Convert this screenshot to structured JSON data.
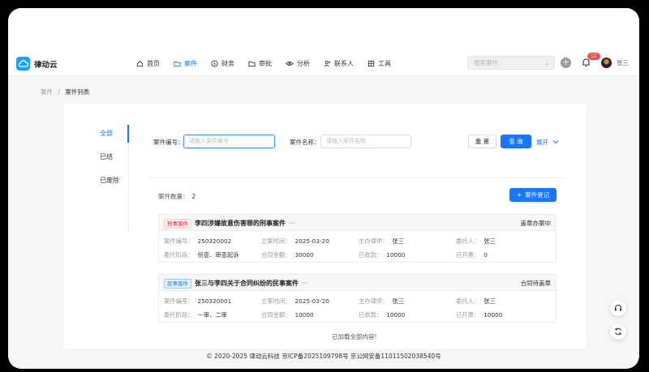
{
  "brand": {
    "name": "律动云"
  },
  "nav": {
    "items": [
      {
        "label": "首页",
        "icon": "home-icon"
      },
      {
        "label": "案件",
        "icon": "folder-icon",
        "active": true
      },
      {
        "label": "财务",
        "icon": "dollar-icon"
      },
      {
        "label": "审批",
        "icon": "folder-check-icon"
      },
      {
        "label": "分析",
        "icon": "eye-icon"
      },
      {
        "label": "联系人",
        "icon": "contacts-icon"
      },
      {
        "label": "工具",
        "icon": "tools-icon"
      }
    ]
  },
  "header": {
    "search_placeholder": "搜索案件",
    "notification_count": "11",
    "username": "张三"
  },
  "breadcrumb": {
    "parent": "案件",
    "separator": "/",
    "current": "案件列表"
  },
  "sidebar": {
    "items": [
      {
        "label": "全部",
        "active": true
      },
      {
        "label": "已结"
      },
      {
        "label": "已废除"
      }
    ]
  },
  "filters": {
    "case_number_label": "案件编号：",
    "case_number_placeholder": "请输入案件编号",
    "case_name_label": "案件名称：",
    "case_name_placeholder": "请输入案件名称",
    "reset_label": "重 置",
    "query_label": "查 询",
    "expand_label": "展开"
  },
  "list": {
    "count_label": "案件数量：",
    "count": "2",
    "register_label": "案件登记",
    "loaded_text": "已加载全部内容!",
    "cases": [
      {
        "tag": "刑事案件",
        "tag_color": "#f5222d",
        "title": "李四涉嫌故意伤害罪的刑事案件",
        "more": "···",
        "status": "盖章办案中",
        "fields": {
          "number": {
            "k": "案件编号：",
            "v": "250320002"
          },
          "date": {
            "k": "立案时间：",
            "v": "2025-03-20"
          },
          "lawyer": {
            "k": "主办律师：",
            "v": "张三"
          },
          "client": {
            "k": "委托人：",
            "v": "张三"
          },
          "stage": {
            "k": "委托阶段：",
            "v": "侦查、审查起诉"
          },
          "amount": {
            "k": "合同金额：",
            "v": "30000"
          },
          "received": {
            "k": "已收款：",
            "v": "10000"
          },
          "invoiced": {
            "k": "已开票：",
            "v": "0"
          }
        }
      },
      {
        "tag": "民事案件",
        "tag_color": "#1677ff",
        "title": "张三与李四关于合同纠纷的民事案件",
        "more": "···",
        "status": "合同待盖章",
        "fields": {
          "number": {
            "k": "案件编号：",
            "v": "250320001"
          },
          "date": {
            "k": "立案时间：",
            "v": "2025-03-20"
          },
          "lawyer": {
            "k": "主办律师：",
            "v": "张三"
          },
          "client": {
            "k": "委托人：",
            "v": "张三"
          },
          "stage": {
            "k": "委托阶段：",
            "v": "一审、二审"
          },
          "amount": {
            "k": "合同金额：",
            "v": "10000"
          },
          "received": {
            "k": "已收款：",
            "v": "10000"
          },
          "invoiced": {
            "k": "已开票：",
            "v": "10000"
          }
        }
      }
    ]
  },
  "footer": {
    "text": "© 2020-2025 律动云科技  京ICP备2025109798号  京公网安备11011502038540号"
  }
}
